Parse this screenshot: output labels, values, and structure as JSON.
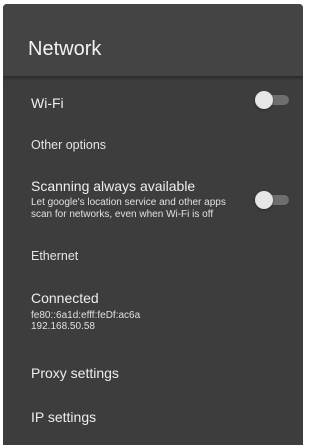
{
  "header": {
    "title": "Network"
  },
  "wifi": {
    "label": "Wi-Fi",
    "enabled": false
  },
  "other_options": {
    "label": "Other options"
  },
  "scanning": {
    "label": "Scanning always available",
    "description": "Let google's location service and other apps\nscan for networks, even when Wi-Fi is off",
    "enabled": false
  },
  "ethernet": {
    "section_label": "Ethernet",
    "status": "Connected",
    "ipv6": "fe80::6a1d:efff:feDf:ac6a",
    "ipv4": "192.168.50.58"
  },
  "proxy_settings": {
    "label": "Proxy settings"
  },
  "ip_settings": {
    "label": "IP settings"
  },
  "colors": {
    "panel_bg": "#3d3d3d",
    "header_bg": "#444444",
    "text": "#eeeeee",
    "toggle_off_track": "#6e6e6e",
    "toggle_off_thumb": "#e6e6e6"
  }
}
